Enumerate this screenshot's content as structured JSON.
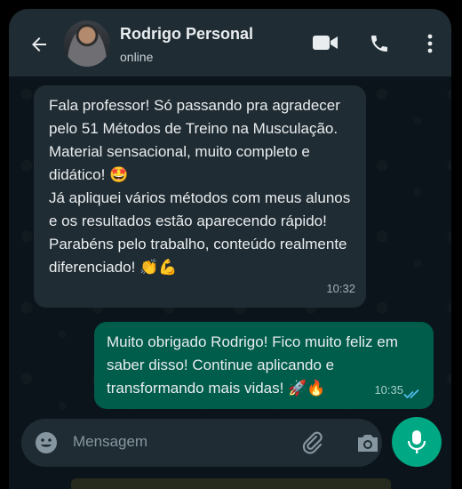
{
  "header": {
    "contact_name": "Rodrigo Personal",
    "status": "online",
    "icons": [
      "back-arrow-icon",
      "video-call-icon",
      "phone-call-icon",
      "more-options-icon"
    ]
  },
  "messages": [
    {
      "direction": "incoming",
      "text": "Fala professor! Só passando pra agradecer pelo 51 Métodos de Treino na Musculação. Material sensacional, muito completo e didático! 🤩\nJá apliquei vários métodos com meus alunos e os resultados estão aparecendo rápido!\nParabéns pelo trabalho, conteúdo realmente diferenciado! 👏💪",
      "time": "10:32"
    },
    {
      "direction": "outgoing",
      "text": "Muito obrigado Rodrigo! Fico muito feliz em saber disso! Continue aplicando e transformando mais vidas! 🚀🔥",
      "time": "10:35",
      "read_status": "read"
    }
  ],
  "composer": {
    "placeholder": "Mensagem",
    "icons": [
      "emoji-icon",
      "attach-icon",
      "camera-icon",
      "mic-icon"
    ]
  },
  "colors": {
    "header_bg": "#1f2c33",
    "chat_bg": "#0b141a",
    "incoming_bubble": "#202c33",
    "outgoing_bubble": "#005c4b",
    "accent": "#00a884",
    "read_ticks": "#53bdeb"
  }
}
